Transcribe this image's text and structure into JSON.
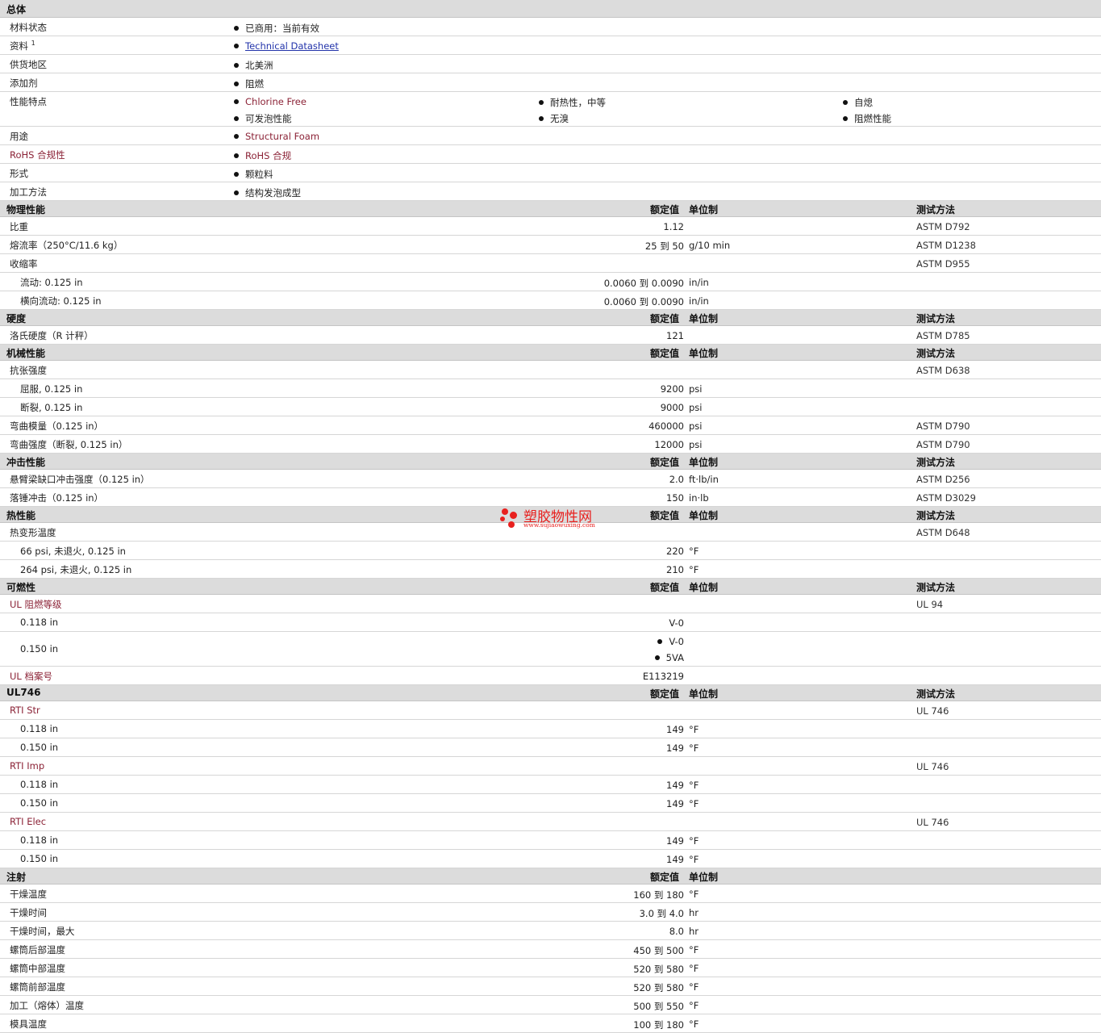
{
  "general": {
    "title": "总体",
    "rows": [
      {
        "label": "材料状态",
        "items": [
          "已商用：当前有效"
        ]
      },
      {
        "label": "资料",
        "sup": "1",
        "link": "Technical Datasheet"
      },
      {
        "label": "供货地区",
        "items": [
          "北美洲"
        ]
      },
      {
        "label": "添加剂",
        "items": [
          "阻燃"
        ]
      },
      {
        "label": "性能特点",
        "items": [
          "Chlorine Free",
          "耐热性，中等",
          "自熄",
          "可发泡性能",
          "无溴",
          "阻燃性能"
        ]
      },
      {
        "label": "用途",
        "items": [
          "Structural Foam"
        ]
      },
      {
        "label": "RoHS 合规性",
        "items": [
          "RoHS 合规"
        ]
      },
      {
        "label": "形式",
        "items": [
          "颗粒料"
        ]
      },
      {
        "label": "加工方法",
        "items": [
          "结构发泡成型"
        ]
      }
    ]
  },
  "columns": {
    "nominal": "额定值",
    "unit": "单位制",
    "test": "测试方法"
  },
  "sections": [
    {
      "title": "物理性能",
      "rows": [
        {
          "label": "比重",
          "value": "1.12",
          "unit": "",
          "test": "ASTM D792"
        },
        {
          "label": "熔流率（250°C/11.6 kg）",
          "value": "25 到  50",
          "unit": "g/10 min",
          "test": "ASTM D1238"
        },
        {
          "label": "收缩率",
          "value": "",
          "unit": "",
          "test": "ASTM D955"
        },
        {
          "label": "流动: 0.125 in",
          "value": "0.0060 到  0.0090",
          "unit": "in/in",
          "test": "",
          "sub": true
        },
        {
          "label": "横向流动: 0.125 in",
          "value": "0.0060 到  0.0090",
          "unit": "in/in",
          "test": "",
          "sub": true
        }
      ]
    },
    {
      "title": "硬度",
      "rows": [
        {
          "label": "洛氏硬度（R 计秤）",
          "value": "121",
          "unit": "",
          "test": "ASTM D785"
        }
      ]
    },
    {
      "title": "机械性能",
      "rows": [
        {
          "label": "抗张强度",
          "value": "",
          "unit": "",
          "test": "ASTM D638"
        },
        {
          "label": "屈服, 0.125 in",
          "value": "9200",
          "unit": "psi",
          "test": "",
          "sub": true
        },
        {
          "label": "断裂, 0.125 in",
          "value": "9000",
          "unit": "psi",
          "test": "",
          "sub": true
        },
        {
          "label": "弯曲模量（0.125 in）",
          "value": "460000",
          "unit": "psi",
          "test": "ASTM D790"
        },
        {
          "label": "弯曲强度（断裂, 0.125 in）",
          "value": "12000",
          "unit": "psi",
          "test": "ASTM D790"
        }
      ]
    },
    {
      "title": "冲击性能",
      "rows": [
        {
          "label": "悬臂梁缺口冲击强度（0.125 in）",
          "value": "2.0",
          "unit": "ft·lb/in",
          "test": "ASTM D256"
        },
        {
          "label": "落锤冲击（0.125 in）",
          "value": "150",
          "unit": "in·lb",
          "test": "ASTM D3029"
        }
      ]
    },
    {
      "title": "热性能",
      "rows": [
        {
          "label": "热变形温度",
          "value": "",
          "unit": "",
          "test": "ASTM D648"
        },
        {
          "label": "66 psi, 未退火, 0.125 in",
          "value": "220",
          "unit": "°F",
          "test": "",
          "sub": true
        },
        {
          "label": "264 psi, 未退火, 0.125 in",
          "value": "210",
          "unit": "°F",
          "test": "",
          "sub": true
        }
      ]
    },
    {
      "title": "可燃性",
      "rows": [
        {
          "label": "UL 阻燃等级",
          "value": "",
          "unit": "",
          "test": "UL 94",
          "red": true
        },
        {
          "label": "0.118 in",
          "value": "V-0",
          "unit": "",
          "test": "",
          "sub": true
        },
        {
          "label": "0.150 in",
          "bullets": [
            "V-0",
            "5VA"
          ],
          "unit": "",
          "test": "",
          "sub": true
        },
        {
          "label": "UL 档案号",
          "value": "E113219",
          "unit": "",
          "test": "",
          "red": true
        }
      ]
    },
    {
      "title": "UL746",
      "rows": [
        {
          "label": "RTI Str",
          "value": "",
          "unit": "",
          "test": "UL 746",
          "red": true
        },
        {
          "label": "0.118 in",
          "value": "149",
          "unit": "°F",
          "test": "",
          "sub": true
        },
        {
          "label": "0.150 in",
          "value": "149",
          "unit": "°F",
          "test": "",
          "sub": true
        },
        {
          "label": "RTI Imp",
          "value": "",
          "unit": "",
          "test": "UL 746",
          "red": true
        },
        {
          "label": "0.118 in",
          "value": "149",
          "unit": "°F",
          "test": "",
          "sub": true
        },
        {
          "label": "0.150 in",
          "value": "149",
          "unit": "°F",
          "test": "",
          "sub": true
        },
        {
          "label": "RTI Elec",
          "value": "",
          "unit": "",
          "test": "UL 746",
          "red": true
        },
        {
          "label": "0.118 in",
          "value": "149",
          "unit": "°F",
          "test": "",
          "sub": true
        },
        {
          "label": "0.150 in",
          "value": "149",
          "unit": "°F",
          "test": "",
          "sub": true
        }
      ]
    },
    {
      "title": "注射",
      "notest": true,
      "rows": [
        {
          "label": "干燥温度",
          "value": "160 到  180",
          "unit": "°F",
          "test": ""
        },
        {
          "label": "干燥时间",
          "value": "3.0 到  4.0",
          "unit": "hr",
          "test": ""
        },
        {
          "label": "干燥时间，最大",
          "value": "8.0",
          "unit": "hr",
          "test": ""
        },
        {
          "label": "螺筒后部温度",
          "value": "450 到  500",
          "unit": "°F",
          "test": ""
        },
        {
          "label": "螺筒中部温度",
          "value": "520 到  580",
          "unit": "°F",
          "test": ""
        },
        {
          "label": "螺筒前部温度",
          "value": "520 到  580",
          "unit": "°F",
          "test": ""
        },
        {
          "label": "加工（熔体）温度",
          "value": "500 到  550",
          "unit": "°F",
          "test": ""
        },
        {
          "label": "模具温度",
          "value": "100 到  180",
          "unit": "°F",
          "test": ""
        }
      ]
    }
  ],
  "watermark": {
    "name": "塑胶物性网",
    "url": "www.sujiaowuxing.com"
  }
}
